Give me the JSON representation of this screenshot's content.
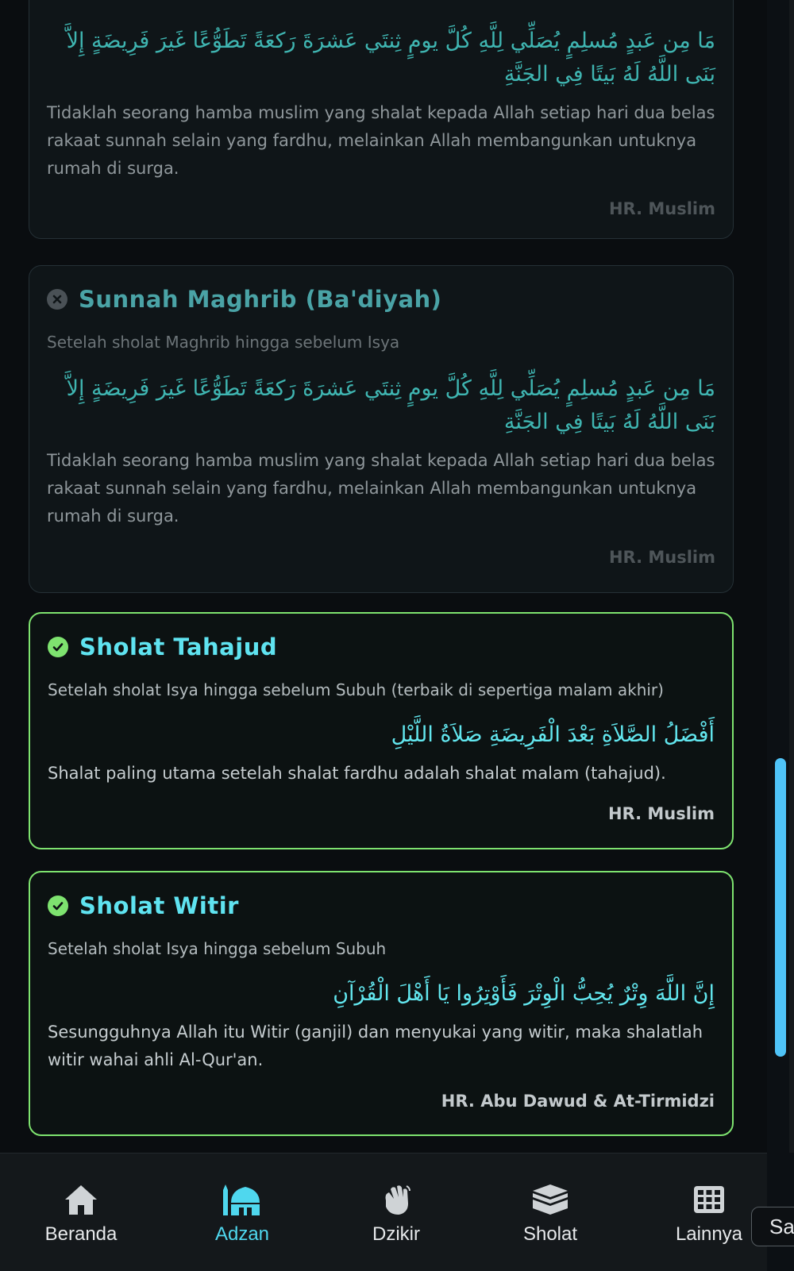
{
  "cards": [
    {
      "status": "pending",
      "title": "",
      "time": "",
      "arabic": "مَا مِن عَبدٍ مُسلِمٍ يُصَلِّي لِلَّهِ كُلَّ يومٍ ثِنتَي عَشرَةَ رَكعَةً تَطَوُّعًا غَيرَ فَرِيضَةٍ إِلاَّ بَنَى اللَّهُ لَهُ بَيتًا فِي الجَنَّةِ",
      "translation": "Tidaklah seorang hamba muslim yang shalat kepada Allah setiap hari dua belas rakaat sunnah selain yang fardhu, melainkan Allah membangunkan untuknya rumah di surga.",
      "source": "HR. Muslim"
    },
    {
      "status": "pending",
      "title": "Sunnah Maghrib (Ba'diyah)",
      "time": "Setelah sholat Maghrib hingga sebelum Isya",
      "arabic": "مَا مِن عَبدٍ مُسلِمٍ يُصَلِّي لِلَّهِ كُلَّ يومٍ ثِنتَي عَشرَةَ رَكعَةً تَطَوُّعًا غَيرَ فَرِيضَةٍ إِلاَّ بَنَى اللَّهُ لَهُ بَيتًا فِي الجَنَّةِ",
      "translation": "Tidaklah seorang hamba muslim yang shalat kepada Allah setiap hari dua belas rakaat sunnah selain yang fardhu, melainkan Allah membangunkan untuknya rumah di surga.",
      "source": "HR. Muslim"
    },
    {
      "status": "done",
      "title": "Sholat Tahajud",
      "time": "Setelah sholat Isya hingga sebelum Subuh (terbaik di sepertiga malam akhir)",
      "arabic": "أَفْضَلُ الصَّلاَةِ بَعْدَ الْفَرِيضَةِ صَلاَةُ اللَّيْلِ",
      "translation": "Shalat paling utama setelah shalat fardhu adalah shalat malam (tahajud).",
      "source": "HR. Muslim"
    },
    {
      "status": "done",
      "title": "Sholat Witir",
      "time": "Setelah sholat Isya hingga sebelum Subuh",
      "arabic": "إِنَّ اللَّهَ وِتْرٌ يُحِبُّ الْوِتْرَ فَأَوْتِرُوا يَا أَهْلَ الْقُرْآنِ",
      "translation": "Sesungguhnya Allah itu Witir (ganjil) dan menyukai yang witir, maka shalatlah witir wahai ahli Al-Qur'an.",
      "source": "HR. Abu Dawud & At-Tirmidzi"
    }
  ],
  "nav": {
    "items": [
      {
        "label": "Beranda",
        "icon": "home-icon"
      },
      {
        "label": "Adzan",
        "icon": "mosque-icon",
        "active": true
      },
      {
        "label": "Dzikir",
        "icon": "hand-icon"
      },
      {
        "label": "Sholat",
        "icon": "kaaba-icon"
      },
      {
        "label": "Lainnya",
        "icon": "grid-icon"
      }
    ]
  },
  "side_button": {
    "label": "Sa"
  },
  "colors": {
    "accent": "#4fd7ee",
    "done_border": "#7ee36f",
    "scrollbar": "#4fc3f7"
  }
}
